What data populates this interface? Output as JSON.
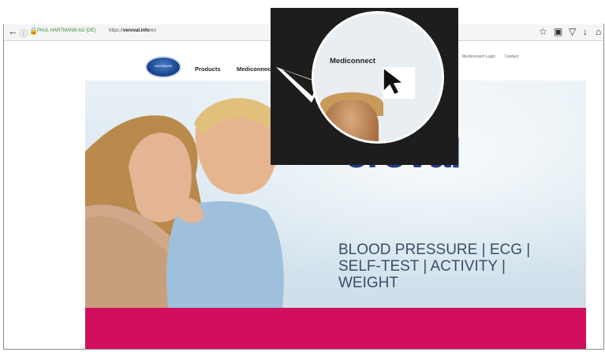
{
  "browser": {
    "company_text": "PAUL HARTMANN AG [DE]",
    "url_prefix": "https://",
    "url_domain": "veroval.info",
    "url_path": "/en"
  },
  "nav": {
    "logo_text": "HARTMANN",
    "items": [
      "Products",
      "Mediconnect"
    ],
    "small_links": [
      "Mediconnect Login",
      "Contact"
    ]
  },
  "hero": {
    "brand": "Veroval®",
    "brand_visible": "eroval",
    "tagline_lines": [
      "BLOOD PRESSURE | ECG |",
      "SELF-TEST | ACTIVITY |",
      "WEIGHT"
    ]
  },
  "magnifier": {
    "label": "Mediconnect"
  },
  "colors": {
    "brand_blue": "#1f3c86",
    "pink": "#d20f5e",
    "callout_black": "#1e1d1d"
  }
}
